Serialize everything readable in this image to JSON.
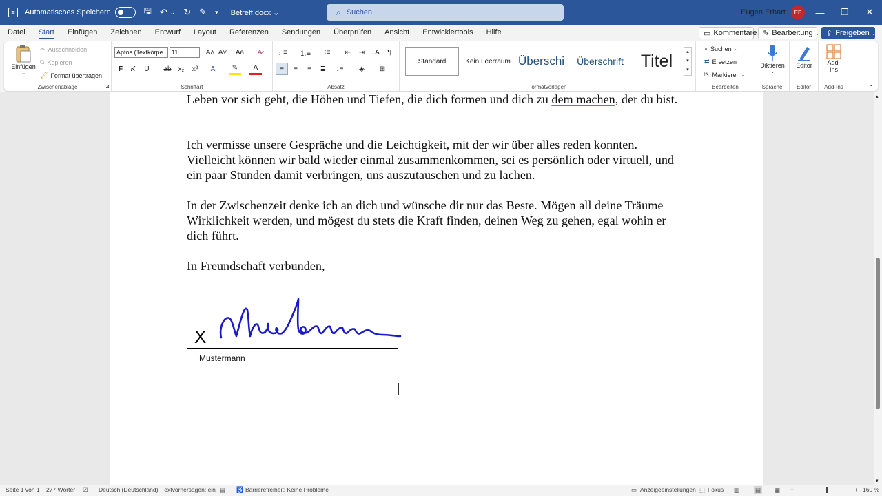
{
  "titlebar": {
    "autosave_label": "Automatisches Speichern",
    "doc_name": "Betreff.docx",
    "search_placeholder": "Suchen",
    "user_name": "Eugen Erhart",
    "user_initials": "EE"
  },
  "menu": [
    "Datei",
    "Start",
    "Einfügen",
    "Zeichnen",
    "Entwurf",
    "Layout",
    "Referenzen",
    "Sendungen",
    "Überprüfen",
    "Ansicht",
    "Entwicklertools",
    "Hilfe"
  ],
  "menu_active": "Start",
  "top_buttons": {
    "comments": "Kommentare",
    "editing": "Bearbeitung",
    "share": "Freigeben"
  },
  "ribbon": {
    "clipboard": {
      "paste": "Einfügen",
      "cut": "Ausschneiden",
      "copy": "Kopieren",
      "format_painter": "Format übertragen",
      "label": "Zwischenablage"
    },
    "font": {
      "name": "Aptos (Textkörpe",
      "size": "11",
      "label": "Schriftart",
      "bold": "F",
      "italic": "K",
      "underline": "U",
      "strike": "ab",
      "sub": "x₂",
      "sup": "x²",
      "grow": "A^",
      "shrink": "A˅",
      "case": "Aa",
      "clear": "A"
    },
    "paragraph": {
      "label": "Absatz"
    },
    "styles": {
      "items": [
        "Standard",
        "Kein Leerraum",
        "Überschi",
        "Überschrift",
        "Titel"
      ],
      "label": "Formatvorlagen"
    },
    "editing": {
      "find": "Suchen",
      "replace": "Ersetzen",
      "select": "Markieren",
      "label": "Bearbeiten"
    },
    "voice": {
      "dictate": "Diktieren",
      "label": "Sprache"
    },
    "editor": {
      "button": "Editor",
      "label": "Editor"
    },
    "addins": {
      "button": "Add-Ins",
      "label": "Add-Ins"
    }
  },
  "document": {
    "para1_a": "Leben vor sich geht, die Höhen und Tiefen, die dich formen und dich zu ",
    "para1_u": "dem machen",
    "para1_b": ", der du bist.",
    "para2": "Ich vermisse unsere Gespräche und die Leichtigkeit, mit der wir über alles reden konnten. Vielleicht können wir bald wieder einmal zusammenkommen, sei es persönlich oder virtuell, und ein paar Stunden damit verbringen, uns auszutauschen und zu lachen.",
    "para3": "In der Zwischenzeit denke ich an dich und wünsche dir nur das Beste. Mögen all deine Träume Wirklichkeit werden, und mögest du stets die Kraft finden, deinen Weg zu gehen, egal wohin er dich führt.",
    "closing": "In Freundschaft verbunden,",
    "signature_x": "X",
    "signer": "Mustermann",
    "signature_color": "#1a1acc"
  },
  "status": {
    "page": "Seite 1 von 1",
    "words": "277 Wörter",
    "language": "Deutsch (Deutschland)",
    "predictions": "Textvorhersagen: ein",
    "accessibility": "Barrierefreiheit: Keine Probleme",
    "display": "Anzeigeeinstellungen",
    "focus": "Fokus",
    "zoom": "160 %"
  }
}
